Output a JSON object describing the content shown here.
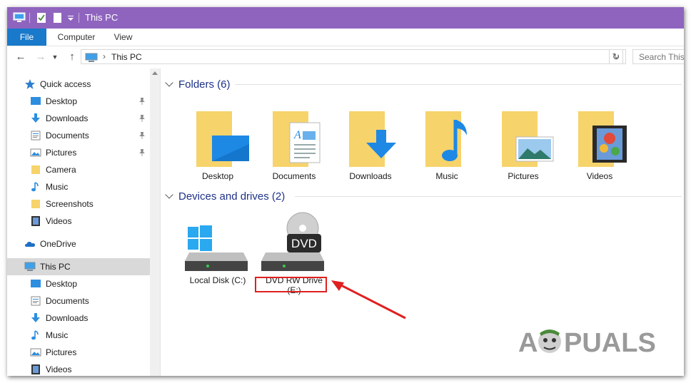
{
  "window": {
    "title": "This PC",
    "qat_dropdown_icon": "chevron-down-icon"
  },
  "ribbon": {
    "tabs": [
      "File",
      "Computer",
      "View"
    ]
  },
  "address_bar": {
    "back_icon": "arrow-left-icon",
    "forward_icon": "arrow-right-icon",
    "history_icon": "chevron-down-icon",
    "up_icon": "arrow-up-icon",
    "location": "This PC",
    "refresh_icon": "refresh-icon",
    "search_placeholder": "Search This"
  },
  "nav_pane": {
    "quick_access": {
      "label": "Quick access",
      "items": [
        {
          "label": "Desktop",
          "icon": "desktop-icon",
          "pinned": true
        },
        {
          "label": "Downloads",
          "icon": "download-icon",
          "pinned": true
        },
        {
          "label": "Documents",
          "icon": "document-icon",
          "pinned": true
        },
        {
          "label": "Pictures",
          "icon": "picture-icon",
          "pinned": true
        },
        {
          "label": "Camera",
          "icon": "folder-icon",
          "pinned": false
        },
        {
          "label": "Music",
          "icon": "music-icon",
          "pinned": false
        },
        {
          "label": "Screenshots",
          "icon": "folder-icon",
          "pinned": false
        },
        {
          "label": "Videos",
          "icon": "video-icon",
          "pinned": false
        }
      ]
    },
    "onedrive": {
      "label": "OneDrive",
      "icon": "cloud-icon"
    },
    "this_pc": {
      "label": "This PC",
      "icon": "computer-icon",
      "items": [
        {
          "label": "Desktop",
          "icon": "desktop-icon"
        },
        {
          "label": "Documents",
          "icon": "document-icon"
        },
        {
          "label": "Downloads",
          "icon": "download-icon"
        },
        {
          "label": "Music",
          "icon": "music-icon"
        },
        {
          "label": "Pictures",
          "icon": "picture-icon"
        },
        {
          "label": "Videos",
          "icon": "video-icon"
        }
      ]
    }
  },
  "folders_group": {
    "header": "Folders (6)",
    "items": [
      {
        "label": "Desktop",
        "icon": "desktop-folder-icon"
      },
      {
        "label": "Documents",
        "icon": "documents-folder-icon"
      },
      {
        "label": "Downloads",
        "icon": "downloads-folder-icon"
      },
      {
        "label": "Music",
        "icon": "music-folder-icon"
      },
      {
        "label": "Pictures",
        "icon": "pictures-folder-icon"
      },
      {
        "label": "Videos",
        "icon": "videos-folder-icon"
      }
    ]
  },
  "devices_group": {
    "header": "Devices and drives (2)",
    "items": [
      {
        "label_line1": "Local Disk (C:)",
        "label_line2": "",
        "icon": "windows-drive-icon"
      },
      {
        "label_line1": "DVD RW Drive",
        "label_line2": "(E:)",
        "icon": "dvd-drive-icon",
        "badge": "DVD"
      }
    ]
  },
  "annotation": {
    "highlight_color": "#e02020",
    "target": "DVD RW Drive (E:)"
  },
  "watermark": {
    "text_left": "A",
    "text_right": "PUALS"
  },
  "colors": {
    "titlebar": "#8f64bf",
    "file_tab": "#1979ca",
    "group_header": "#1e3287",
    "folder_yellow": "#f6d36b",
    "accent_blue": "#1e88e5"
  }
}
